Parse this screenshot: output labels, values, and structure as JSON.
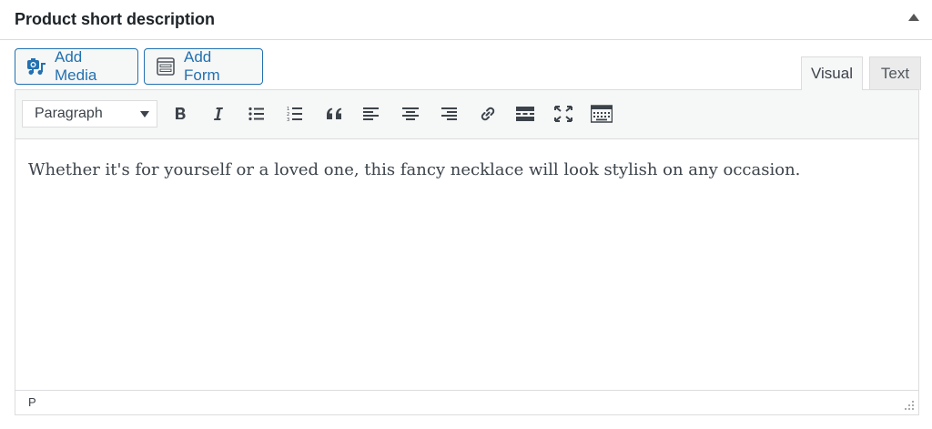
{
  "panel": {
    "title": "Product short description"
  },
  "media_buttons": {
    "add_media": {
      "label": "Add Media",
      "icon": "media-camera-music-icon"
    },
    "add_form": {
      "label": "Add Form",
      "icon": "form-icon"
    }
  },
  "tabs": {
    "visual": "Visual",
    "text": "Text",
    "active": "Visual"
  },
  "toolbar": {
    "format_select": "Paragraph",
    "buttons": [
      "bold-icon",
      "italic-icon",
      "bulleted-list-icon",
      "numbered-list-icon",
      "blockquote-icon",
      "align-left-icon",
      "align-center-icon",
      "align-right-icon",
      "link-icon",
      "read-more-icon",
      "fullscreen-icon",
      "toolbar-toggle-icon"
    ]
  },
  "editor": {
    "content": "Whether it's for yourself or a loved one, this fancy necklace will look stylish on any occasion."
  },
  "statusbar": {
    "path": "P"
  },
  "colors": {
    "accent": "#2271b1",
    "toolbar_bg": "#f6f7f7",
    "border": "#dcdcde",
    "text": "#3c434a"
  }
}
